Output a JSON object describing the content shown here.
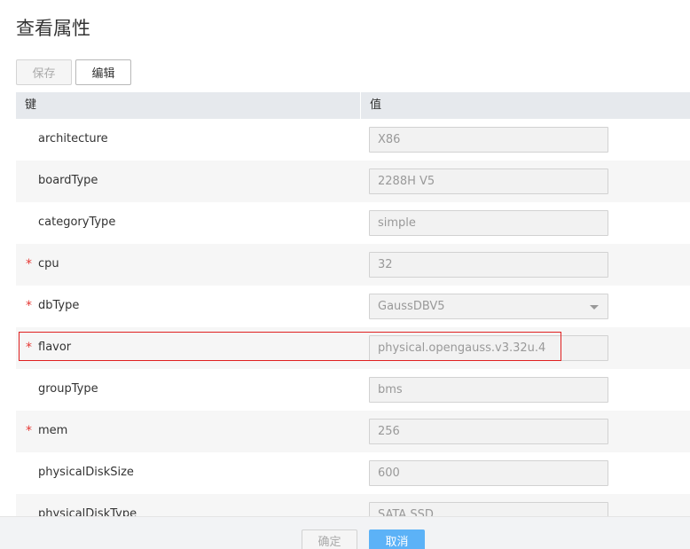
{
  "page": {
    "title": "查看属性"
  },
  "toolbar": {
    "save_label": "保存",
    "edit_label": "编辑"
  },
  "table": {
    "header_key": "键",
    "header_value": "值",
    "rows": [
      {
        "key": "architecture",
        "value": "X86",
        "required": false
      },
      {
        "key": "boardType",
        "value": "2288H V5",
        "required": false
      },
      {
        "key": "categoryType",
        "value": "simple",
        "required": false
      },
      {
        "key": "cpu",
        "value": "32",
        "required": true
      },
      {
        "key": "dbType",
        "value": "GaussDBV5",
        "required": true,
        "control": "dropdown"
      },
      {
        "key": "flavor",
        "value": "physical.opengauss.v3.32u.4",
        "required": true,
        "highlighted": true
      },
      {
        "key": "groupType",
        "value": "bms",
        "required": false
      },
      {
        "key": "mem",
        "value": "256",
        "required": true
      },
      {
        "key": "physicalDiskSize",
        "value": "600",
        "required": false
      },
      {
        "key": "physicalDiskType",
        "value": "SATA SSD",
        "required": false
      }
    ],
    "required_marker": "*"
  },
  "footer": {
    "confirm_label": "确定",
    "cancel_label": "取消"
  },
  "colors": {
    "required": "#e53935",
    "highlight_border": "#e02020",
    "primary_button": "#5cb2f7",
    "header_bg": "#e6e9ed"
  }
}
